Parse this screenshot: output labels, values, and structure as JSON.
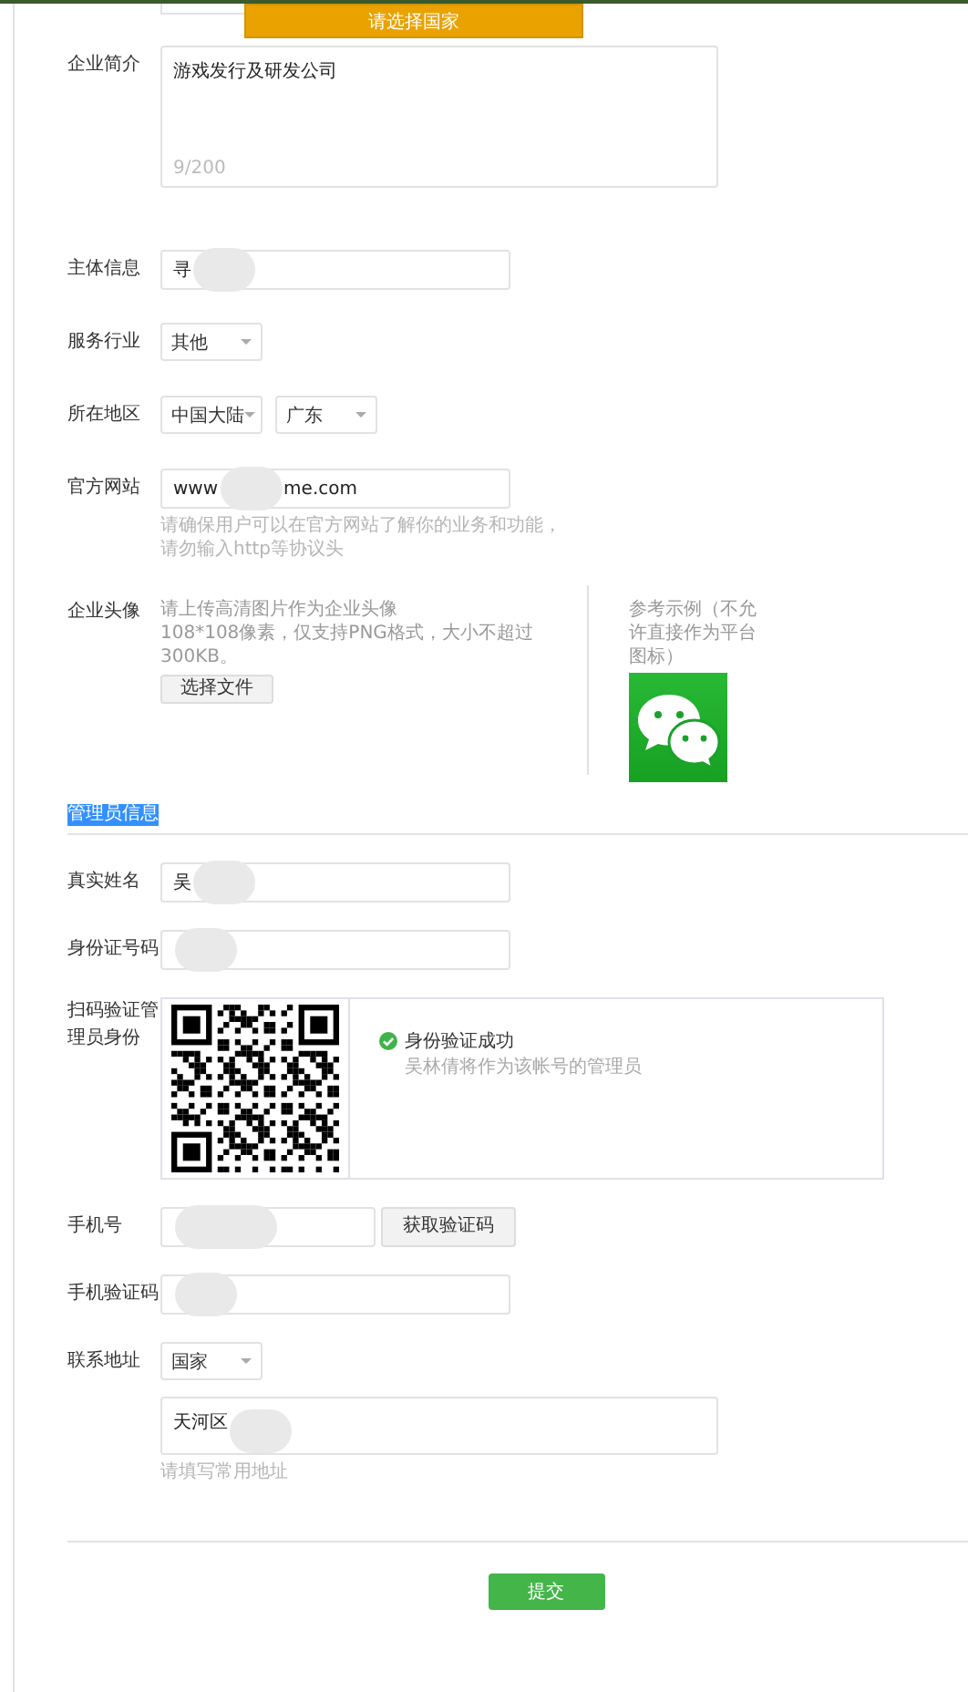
{
  "tooltip": {
    "text": "请选择国家"
  },
  "company_rows": [
    {
      "kind": "textarea",
      "label": "企业简介",
      "value": "游戏发行及研发公司",
      "counter": "9/200"
    },
    {
      "kind": "input",
      "label": "主体信息",
      "value": "寻",
      "redacted": true
    },
    {
      "kind": "select",
      "label": "服务行业",
      "selects": [
        "其他"
      ]
    },
    {
      "kind": "select",
      "label": "所在地区",
      "selects": [
        "中国大陆",
        "广东"
      ]
    },
    {
      "kind": "input",
      "label": "官方网站",
      "value": "www",
      "value_end": "me.com",
      "redacted": true,
      "hint": [
        "请确保用户可以在官方网站了解你的业务和功能，",
        "请勿输入http等协议头"
      ]
    },
    {
      "kind": "avatar",
      "label": "企业头像",
      "description": [
        "请上传高清图片作为企业头像",
        "108*108像素，仅支持PNG格式，大小不超过",
        "300KB。"
      ],
      "button": "选择文件",
      "reference": [
        "参考示例（不允",
        "许直接作为平台",
        "图标）"
      ]
    }
  ],
  "admin_section": {
    "title": "管理员信息",
    "highlighted": true,
    "rows": [
      {
        "kind": "input",
        "label": "真实姓名",
        "value": "吴",
        "redacted": true
      },
      {
        "kind": "input",
        "label": "身份证号码",
        "redacted": true
      },
      {
        "kind": "qr",
        "label": "扫码验证管理员身份",
        "verified": true,
        "status": "身份验证成功",
        "note": "吴林倩将作为该帐号的管理员"
      },
      {
        "kind": "input_button",
        "label": "手机号",
        "redacted": true,
        "button": "获取验证码"
      },
      {
        "kind": "input",
        "label": "手机验证码",
        "redacted": true
      },
      {
        "kind": "address",
        "label": "联系地址",
        "selects": [
          "国家"
        ],
        "value": "天河区",
        "redacted": true,
        "hint": [
          "请填写常用地址"
        ]
      }
    ]
  },
  "submit": {
    "label": "提交"
  }
}
